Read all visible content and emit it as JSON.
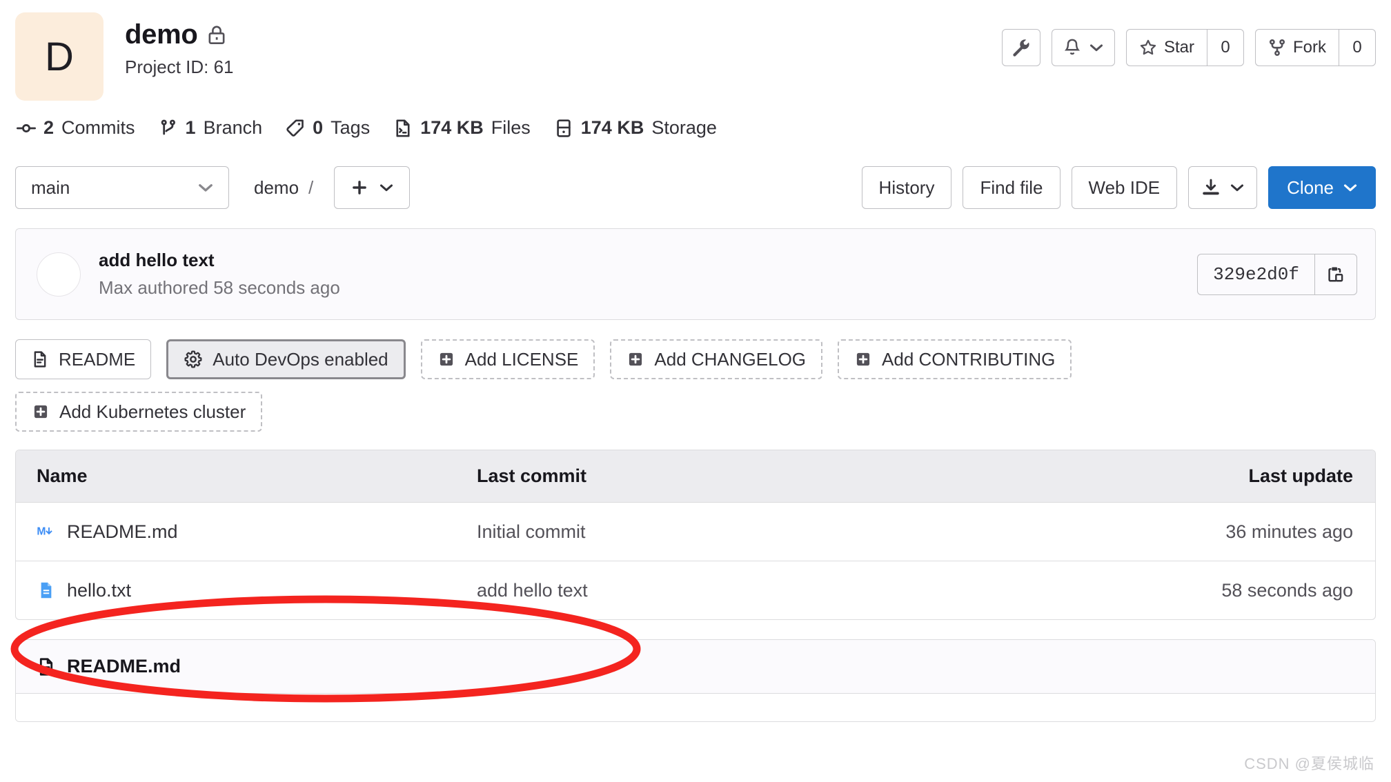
{
  "project": {
    "avatar_letter": "D",
    "avatar_bg": "#fceddc",
    "name": "demo",
    "visibility_icon": "lock-icon",
    "project_id_label": "Project ID: 61"
  },
  "header_actions": {
    "settings_icon": "wrench-icon",
    "notifications_icon": "bell-icon",
    "notifications_caret": "chevron-down-icon",
    "star": {
      "icon": "star-icon",
      "label": "Star",
      "count": "0"
    },
    "fork": {
      "icon": "fork-icon",
      "label": "Fork",
      "count": "0"
    }
  },
  "stats": [
    {
      "icon": "commit-icon",
      "value": "2",
      "unit": "Commits"
    },
    {
      "icon": "branch-icon",
      "value": "1",
      "unit": "Branch"
    },
    {
      "icon": "tag-icon",
      "value": "0",
      "unit": "Tags"
    },
    {
      "icon": "file-code-icon",
      "value": "174 KB",
      "unit": "Files"
    },
    {
      "icon": "storage-icon",
      "value": "174 KB",
      "unit": "Storage"
    }
  ],
  "ref_row": {
    "branch_selected": "main",
    "branch_caret": "chevron-down-icon",
    "breadcrumb_project": "demo",
    "breadcrumb_separator": "/",
    "add_icon": "plus-icon",
    "add_caret": "chevron-down-icon",
    "history_label": "History",
    "find_file_label": "Find file",
    "web_ide_label": "Web IDE",
    "download_icon": "download-icon",
    "download_caret": "chevron-down-icon",
    "clone_label": "Clone",
    "clone_caret": "chevron-down-icon",
    "clone_color": "#1f75cb"
  },
  "commit_panel": {
    "title": "add hello text",
    "meta": "Max authored 58 seconds ago",
    "sha": "329e2d0f",
    "copy_icon": "copy-icon"
  },
  "quick_actions": {
    "row1": [
      {
        "icon": "file-doc-icon",
        "label": "README",
        "style": "solid"
      },
      {
        "icon": "gear-icon",
        "label": "Auto DevOps enabled",
        "style": "active"
      },
      {
        "icon": "plus-square-icon",
        "label": "Add LICENSE",
        "style": "dashed"
      },
      {
        "icon": "plus-square-icon",
        "label": "Add CHANGELOG",
        "style": "dashed"
      },
      {
        "icon": "plus-square-icon",
        "label": "Add CONTRIBUTING",
        "style": "dashed"
      }
    ],
    "row2": [
      {
        "icon": "plus-square-icon",
        "label": "Add Kubernetes cluster",
        "style": "dashed"
      }
    ]
  },
  "file_tree": {
    "columns": {
      "name": "Name",
      "last_commit": "Last commit",
      "last_update": "Last update"
    },
    "rows": [
      {
        "icon": "markdown-file-icon",
        "name": "README.md",
        "last_commit": "Initial commit",
        "last_update": "36 minutes ago"
      },
      {
        "icon": "text-file-icon",
        "name": "hello.txt",
        "last_commit": "add hello text",
        "last_update": "58 seconds ago"
      }
    ]
  },
  "readme_card": {
    "icon": "file-doc-icon",
    "title": "README.md"
  },
  "annotation": {
    "shape": "ellipse",
    "color": "#f4241f",
    "target": "hello.txt row"
  },
  "watermark": "CSDN @夏侯城临"
}
